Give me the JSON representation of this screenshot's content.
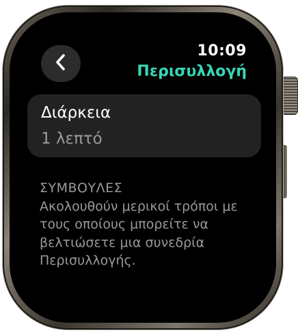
{
  "status": {
    "time": "10:09"
  },
  "header": {
    "title": "Περισυλλογή",
    "back_icon": "chevron-left-icon"
  },
  "duration_card": {
    "label": "Διάρκεια",
    "value": "1 λεπτό"
  },
  "tips": {
    "heading": "ΣΥΜΒΟΥΛΕΣ",
    "body": "Ακολουθούν μερικοί τρόποι με τους οποίους μπορείτε να βελτιώσετε μια συνεδρία Περισυλλογής."
  },
  "colors": {
    "accent": "#37d7b6",
    "background": "#000000",
    "card": "#222222",
    "secondary_text": "#9a9a9a"
  }
}
